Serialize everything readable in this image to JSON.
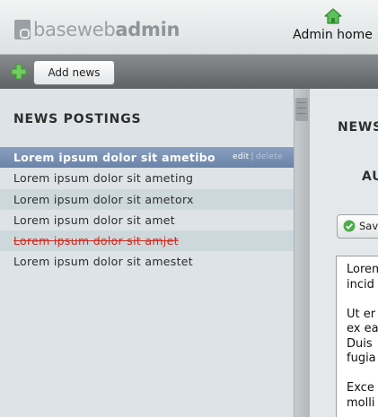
{
  "header": {
    "logo_light": "baseweb",
    "logo_bold": "admin",
    "home_icon": "home-icon",
    "home_label": "Admin home"
  },
  "toolbar": {
    "add_icon": "plus-icon",
    "add_label": "Add news"
  },
  "sidebar": {
    "title": "NEWS POSTINGS",
    "items": [
      {
        "label": "Lorem ipsum dolor sit ametibo",
        "state": "selected"
      },
      {
        "label": "Lorem ipsum dolor sit ameting",
        "state": "normal"
      },
      {
        "label": "Lorem ipsum dolor sit ametorx",
        "state": "alt"
      },
      {
        "label": "Lorem ipsum dolor sit amet",
        "state": "normal"
      },
      {
        "label": "Lorem ipsum dolor sit amjet",
        "state": "deleted"
      },
      {
        "label": "Lorem ipsum dolor sit amestet",
        "state": "normal"
      }
    ],
    "row_actions": {
      "edit": "edit",
      "separator": "|",
      "delete": "delete"
    }
  },
  "main": {
    "title": "NEWS",
    "section_title": "AU",
    "save_label": "Sav",
    "save_icon": "check-icon",
    "editor_lines": [
      [
        "Lorem",
        "incid"
      ],
      [
        "Ut er",
        "ex ea",
        "Duis",
        "fugia"
      ],
      [
        "Exce",
        "molli"
      ]
    ]
  },
  "colors": {
    "selected_row": "#7a92b4",
    "alt_row": "#ccd8dc",
    "deleted_text": "#cc2a1e",
    "toolbar": "#6e7173",
    "add_icon": "#5cc15a",
    "home_icon": "#4caf4a"
  }
}
